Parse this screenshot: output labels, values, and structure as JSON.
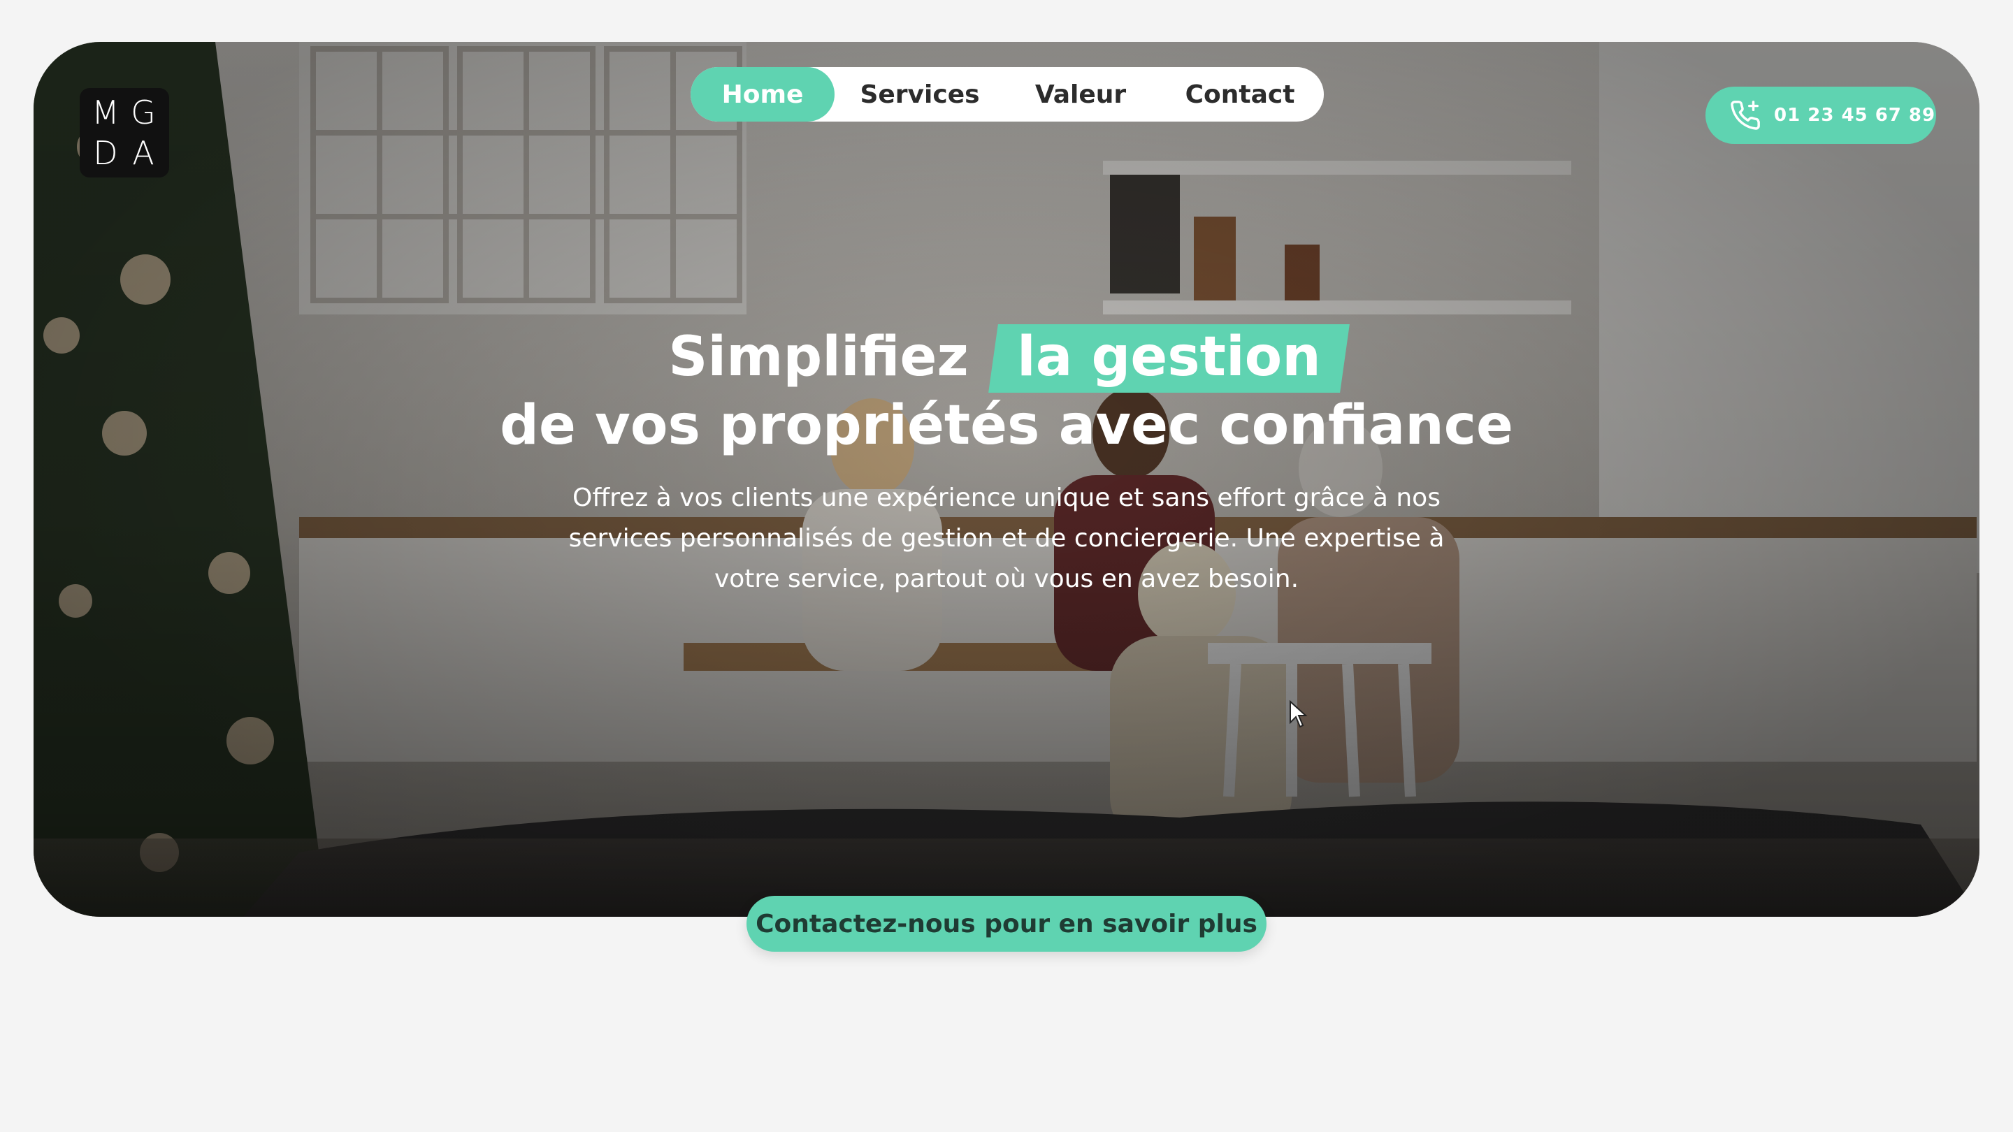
{
  "logo": {
    "letters": [
      "M",
      "G",
      "D",
      "A"
    ]
  },
  "nav": {
    "items": [
      {
        "label": "Home",
        "active": true
      },
      {
        "label": "Services",
        "active": false
      },
      {
        "label": "Valeur",
        "active": false
      },
      {
        "label": "Contact",
        "active": false
      }
    ]
  },
  "phone": {
    "number": "01 23 45 67 89",
    "icon": "phone-plus-icon"
  },
  "hero": {
    "headline_start": "Simplifiez",
    "headline_highlight": "la gestion",
    "headline_line2": "de vos propriétés avec confiance",
    "description": "Offrez à vos clients une expérience unique et sans effort grâce à nos services personnalisés de gestion et de conciergerie. Une expertise à votre service, partout où vous en avez besoin.",
    "background": "kitchen-family-dinner-photo"
  },
  "cta": {
    "label": "Contactez-nous pour en savoir plus"
  },
  "colors": {
    "accent": "#5fd3b1",
    "page_bg": "#f4f4f4"
  }
}
